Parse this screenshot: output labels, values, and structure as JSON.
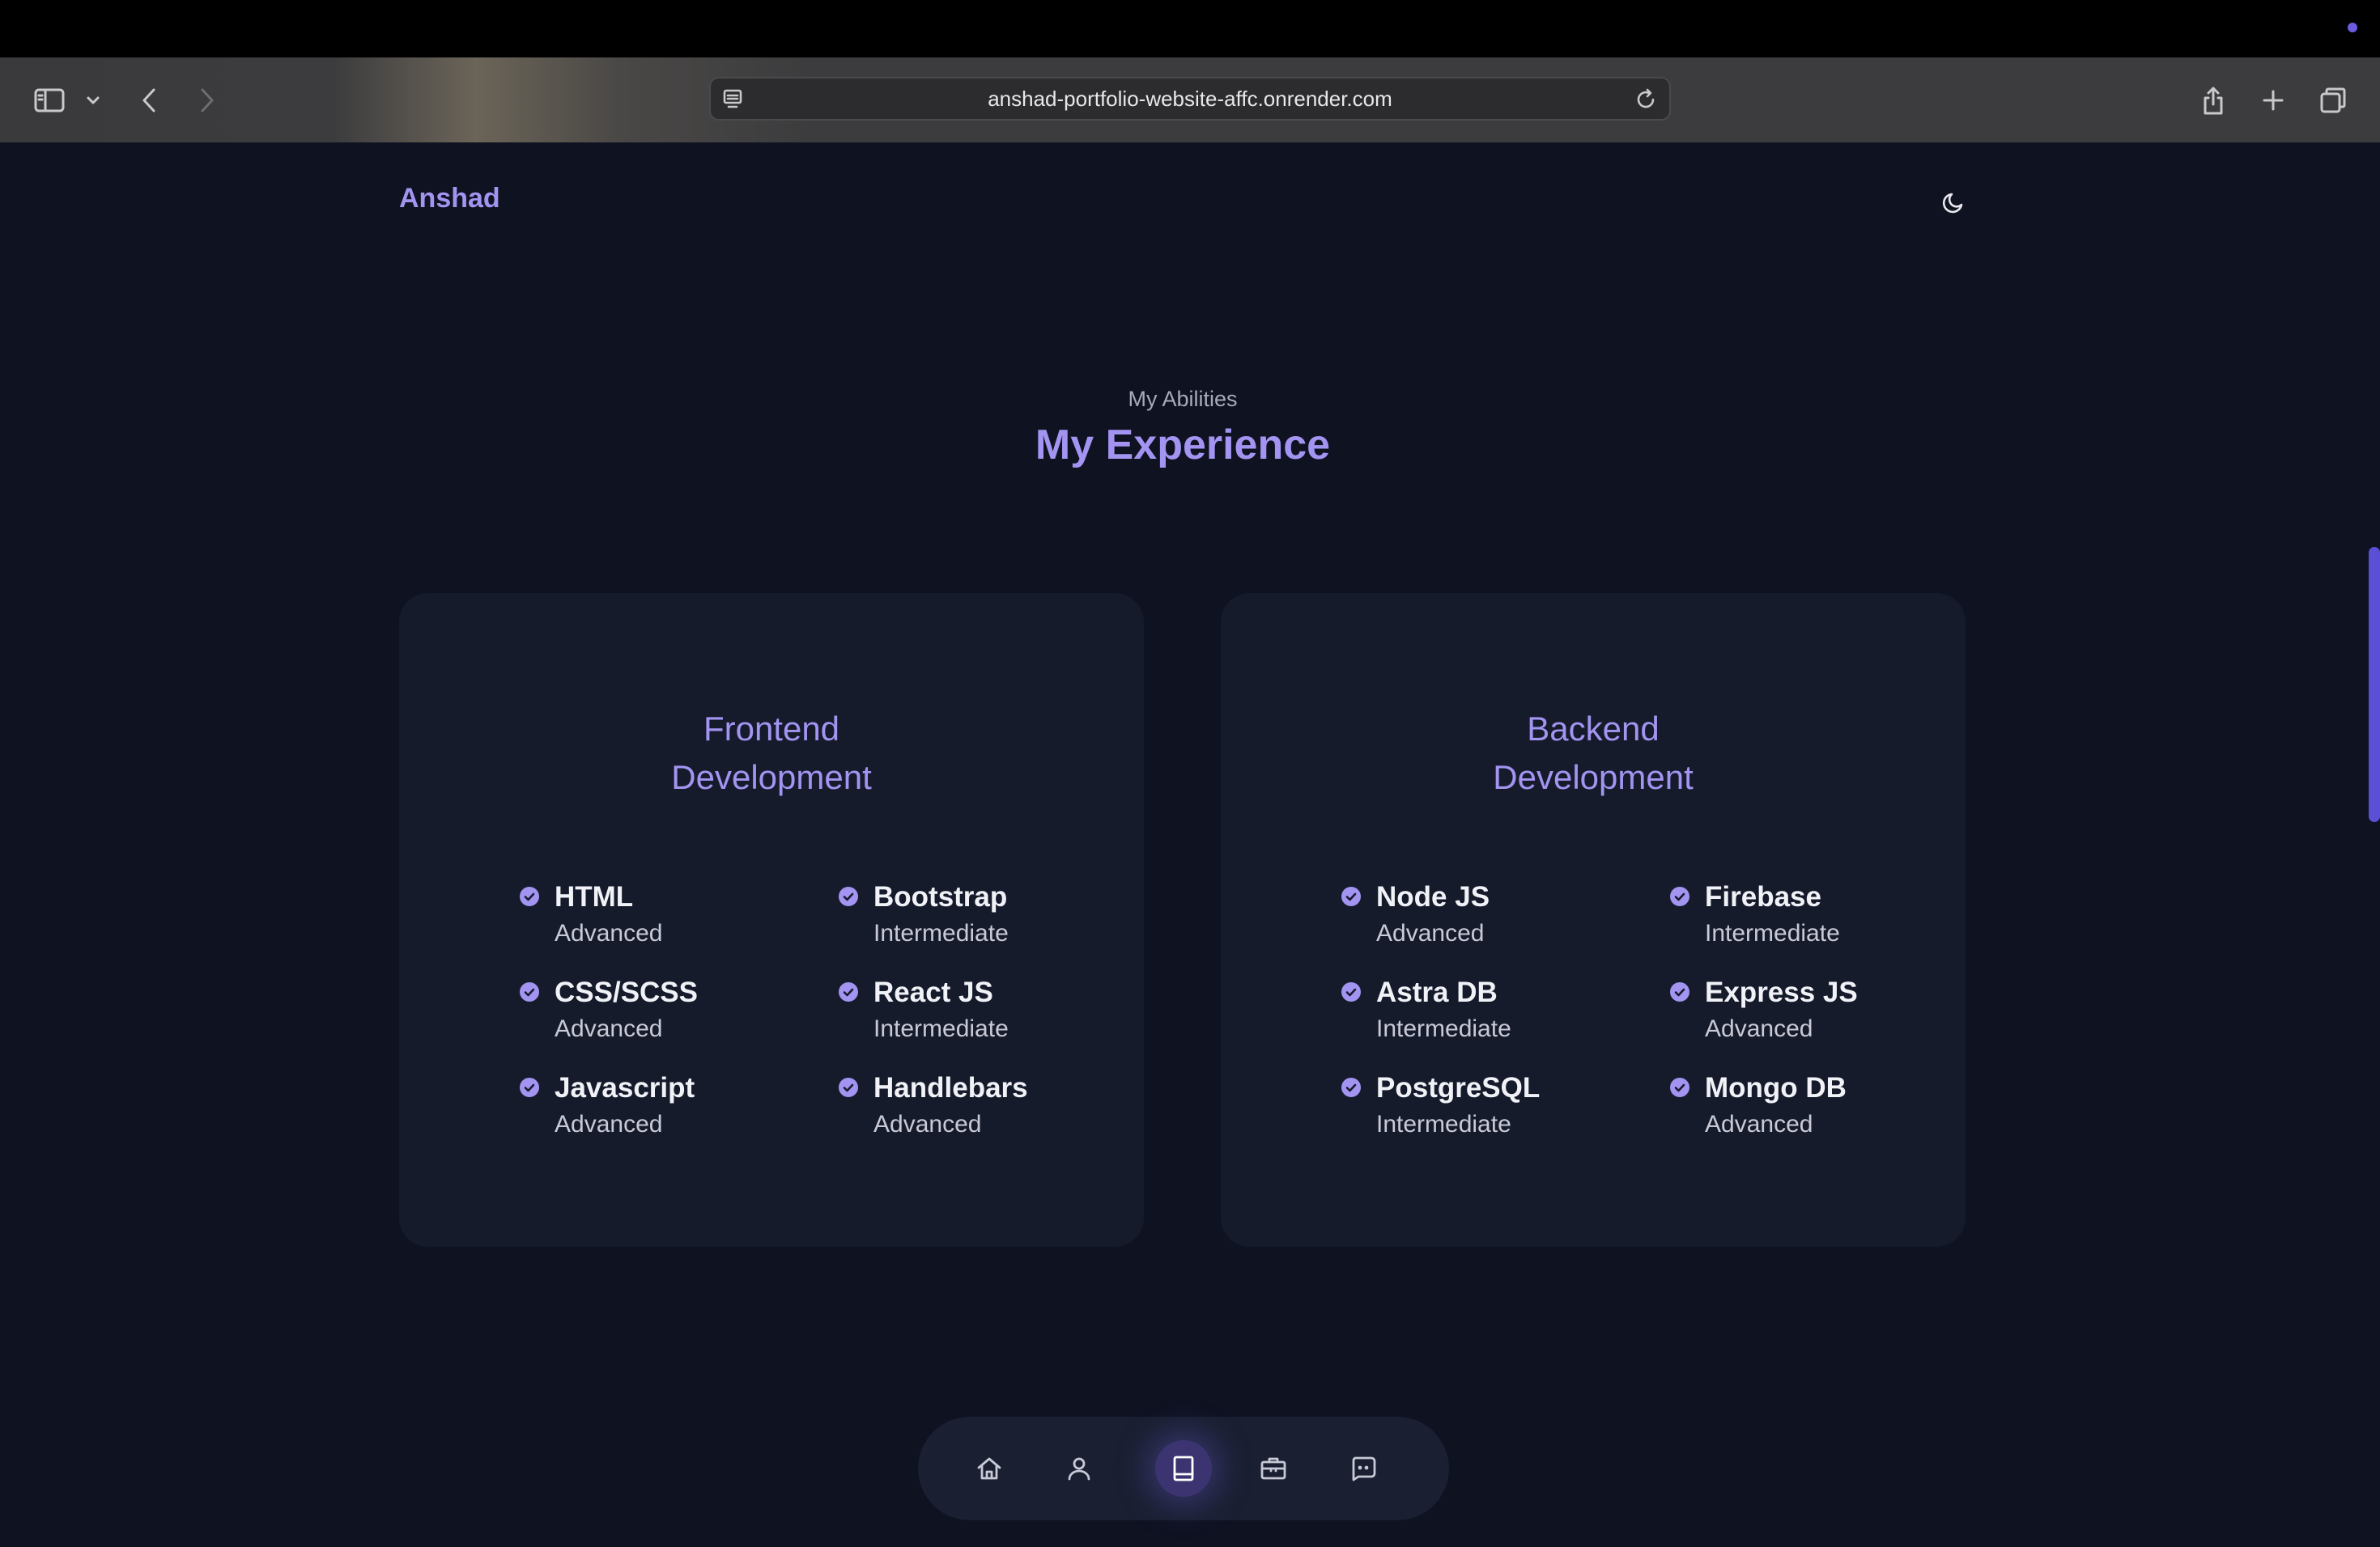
{
  "browser": {
    "url": "anshad-portfolio-website-affc.onrender.com",
    "icons": {
      "sidebar": "sidebar-icon",
      "chevron": "chevron-down-icon",
      "back": "back-arrow-icon",
      "forward": "forward-arrow-icon",
      "site": "site-settings-icon",
      "reload": "reload-icon",
      "share": "share-icon",
      "new_tab": "plus-icon",
      "tabs": "tab-overview-icon"
    }
  },
  "header": {
    "brand": "Anshad",
    "theme_icon": "moon-icon"
  },
  "section": {
    "subtitle": "My Abilities",
    "title": "My Experience"
  },
  "frontend": {
    "title": "Frontend\nDevelopment",
    "skills": [
      {
        "name": "HTML",
        "level": "Advanced"
      },
      {
        "name": "Bootstrap",
        "level": "Intermediate"
      },
      {
        "name": "CSS/SCSS",
        "level": "Advanced"
      },
      {
        "name": "React JS",
        "level": "Intermediate"
      },
      {
        "name": "Javascript",
        "level": "Advanced"
      },
      {
        "name": "Handlebars",
        "level": "Advanced"
      }
    ]
  },
  "backend": {
    "title": "Backend\nDevelopment",
    "skills": [
      {
        "name": "Node JS",
        "level": "Advanced"
      },
      {
        "name": "Firebase",
        "level": "Intermediate"
      },
      {
        "name": "Astra DB",
        "level": "Intermediate"
      },
      {
        "name": "Express JS",
        "level": "Advanced"
      },
      {
        "name": "PostgreSQL",
        "level": "Intermediate"
      },
      {
        "name": "Mongo DB",
        "level": "Advanced"
      }
    ]
  },
  "bottom_nav": {
    "items": [
      "home-icon",
      "user-icon",
      "book-icon",
      "briefcase-icon",
      "message-icon"
    ],
    "active": "book-icon"
  },
  "colors": {
    "background": "#0f1221",
    "card": "#161b2c",
    "accent": "#a294f0"
  }
}
